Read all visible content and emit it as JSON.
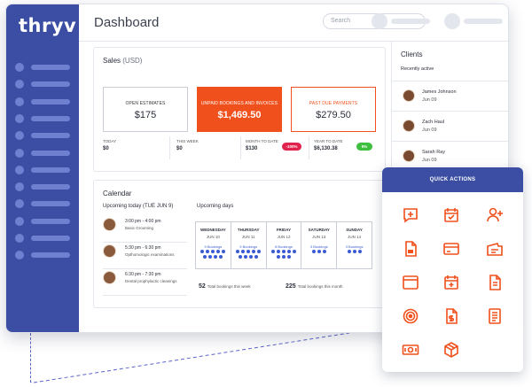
{
  "brand": {
    "logo_text": "thryv"
  },
  "header": {
    "title": "Dashboard",
    "search_placeholder": "Search"
  },
  "sales": {
    "title": "Sales",
    "currency": "(USD)",
    "kpis": [
      {
        "label": "OPEN ESTIMATES",
        "value": "$175",
        "style": "plain"
      },
      {
        "label": "UNPAID BOOKINGS AND INVOICES",
        "value": "$1,469.50",
        "style": "filled"
      },
      {
        "label": "PAST DUE PAYMENTS",
        "value": "$279.50",
        "style": "outlined"
      }
    ],
    "stats": [
      {
        "label": "TODAY",
        "value": "$0"
      },
      {
        "label": "THIS WEEK",
        "value": "$0"
      },
      {
        "label": "MONTH TO DATE",
        "value": "$130",
        "badge": "-100%",
        "badge_color": "#e0224c"
      },
      {
        "label": "YEAR TO DATE",
        "value": "$6,130.38",
        "badge": "5%",
        "badge_color": "#3fbf3f"
      }
    ]
  },
  "calendar": {
    "title": "Calendar",
    "today_heading": "Upcoming today (TUE JUN 9)",
    "upcoming_heading": "Upcoming days",
    "appointments": [
      {
        "time": "3:00 pm - 4:00 pm",
        "description": "Basic Grooming"
      },
      {
        "time": "5:30 pm - 6:30 pm",
        "description": "Opthomologic examinations"
      },
      {
        "time": "6:30 pm - 7:30 pm",
        "description": "Dental prophylactic cleanings"
      }
    ],
    "days": [
      {
        "name": "WEDNESDAY",
        "date": "JUN 10",
        "bookings": "9 Bookings",
        "count": 9
      },
      {
        "name": "THURSDAY",
        "date": "JUN 11",
        "bookings": "9 Bookings",
        "count": 9
      },
      {
        "name": "FRIDAY",
        "date": "JUN 12",
        "bookings": "8 Bookings",
        "count": 8
      },
      {
        "name": "SATURDAY",
        "date": "JUN 13",
        "bookings": "3 Bookings",
        "count": 3
      },
      {
        "name": "SUNDAY",
        "date": "JUN 14",
        "bookings": "3 Bookings",
        "count": 3
      }
    ],
    "totals": [
      {
        "number": "52",
        "label": "Total bookings this week"
      },
      {
        "number": "225",
        "label": "Total bookings this month"
      }
    ]
  },
  "clients": {
    "title": "Clients",
    "subtitle": "Recently active",
    "items": [
      {
        "name": "James Johnson",
        "date": "Jun 09"
      },
      {
        "name": "Zach Haul",
        "date": "Jun 09"
      },
      {
        "name": "Sarah Ray",
        "date": "Jun 09"
      }
    ]
  },
  "quick_actions": {
    "title": "QUICK ACTIONS",
    "icon_color": "#f0501c",
    "icons": [
      "add-comment-icon",
      "calendar-check-icon",
      "add-user-icon",
      "document-icon",
      "credit-card-icon",
      "ticket-icon",
      "browser-window-icon",
      "calendar-plus-icon",
      "file-icon",
      "target-icon",
      "invoice-dollar-icon",
      "list-document-icon",
      "cash-icon",
      "package-icon"
    ]
  },
  "colors": {
    "brand_blue": "#3b4ea3",
    "accent_orange": "#f0501c",
    "booking_blue": "#3b5bd0"
  }
}
